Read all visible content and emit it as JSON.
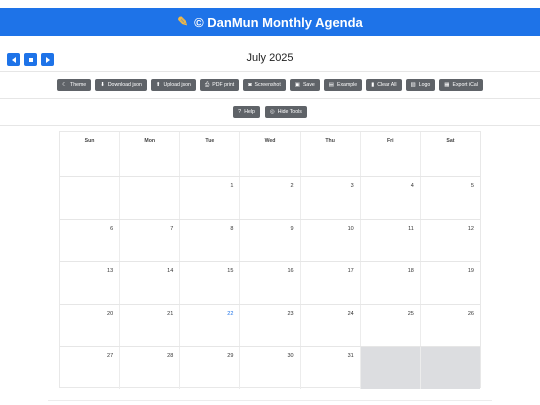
{
  "app": {
    "title": "© DanMun Monthly Agenda",
    "title_icon": "pencil-icon"
  },
  "navigation": {
    "month_label": "July 2025"
  },
  "toolbar": [
    {
      "label": "Theme",
      "icon": "moon-icon",
      "glyph": "☾"
    },
    {
      "label": "Download json",
      "icon": "download-icon",
      "glyph": "⬇"
    },
    {
      "label": "Upload json",
      "icon": "upload-icon",
      "glyph": "⬆"
    },
    {
      "label": "PDF print",
      "icon": "printer-icon",
      "glyph": "⎙"
    },
    {
      "label": "Screenshot",
      "icon": "camera-icon",
      "glyph": "◙"
    },
    {
      "label": "Save",
      "icon": "save-icon",
      "glyph": "▣"
    },
    {
      "label": "Example",
      "icon": "briefcase-icon",
      "glyph": "▤"
    },
    {
      "label": "Clear All",
      "icon": "trash-icon",
      "glyph": "▮"
    },
    {
      "label": "Logo",
      "icon": "image-icon",
      "glyph": "▧"
    },
    {
      "label": "Export iCal",
      "icon": "calendar-icon",
      "glyph": "▦"
    }
  ],
  "toolbar2": [
    {
      "label": "Help",
      "icon": "question-icon",
      "glyph": "?"
    },
    {
      "label": "Hide Tools",
      "icon": "eye-slash-icon",
      "glyph": "◎"
    }
  ],
  "calendar": {
    "days_of_week": [
      "Sun",
      "Mon",
      "Tue",
      "Wed",
      "Thu",
      "Fri",
      "Sat"
    ],
    "weeks": [
      [
        "",
        "",
        "1",
        "2",
        "3",
        "4",
        "5"
      ],
      [
        "6",
        "7",
        "8",
        "9",
        "10",
        "11",
        "12"
      ],
      [
        "13",
        "14",
        "15",
        "16",
        "17",
        "18",
        "19"
      ],
      [
        "20",
        "21",
        "22",
        "23",
        "24",
        "25",
        "26"
      ],
      [
        "27",
        "28",
        "29",
        "30",
        "31",
        "",
        ""
      ]
    ],
    "today": "22"
  },
  "colors": {
    "accent": "#1e73e8",
    "button": "#5f6368",
    "filler": "#dcdde0"
  }
}
